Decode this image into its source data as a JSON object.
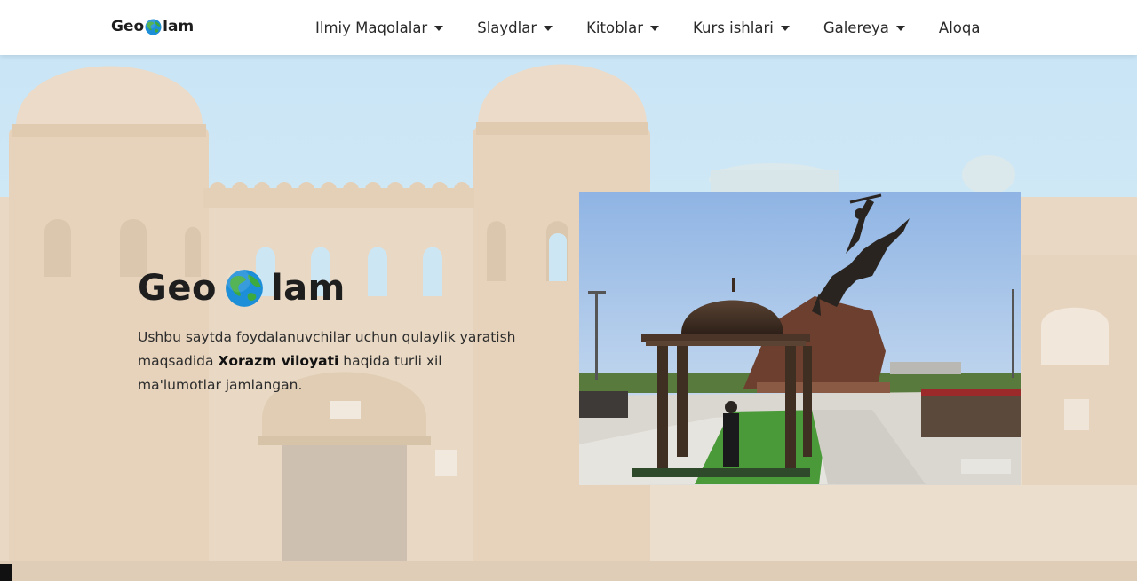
{
  "header": {
    "logo_left": "Geo",
    "logo_right": "lam",
    "nav": [
      {
        "label": "Ilmiy Maqolalar",
        "has_dropdown": true
      },
      {
        "label": "Slaydlar",
        "has_dropdown": true
      },
      {
        "label": "Kitoblar",
        "has_dropdown": true
      },
      {
        "label": "Kurs ishlari",
        "has_dropdown": true
      },
      {
        "label": "Galereya",
        "has_dropdown": true
      },
      {
        "label": "Aloqa",
        "has_dropdown": false
      }
    ]
  },
  "hero": {
    "title_left": "Geo",
    "title_right": "lam",
    "desc_before": "Ushbu saytda foydalanuvchilar uchun qulaylik yaratish maqsadida ",
    "desc_bold": "Xorazm viloyati",
    "desc_after": " haqida turli xil ma'lumotlar jamlangan."
  },
  "icons": {
    "logo_globe": "globe-asia-icon",
    "title_globe": "globe-asia-icon",
    "nav_caret": "caret-down-icon"
  },
  "colors": {
    "sky": "#c9e6f6",
    "brick": "#e4cfb4",
    "ocean": "#1d8fd8",
    "land": "#3daa3f",
    "text": "#1e1e1e"
  }
}
